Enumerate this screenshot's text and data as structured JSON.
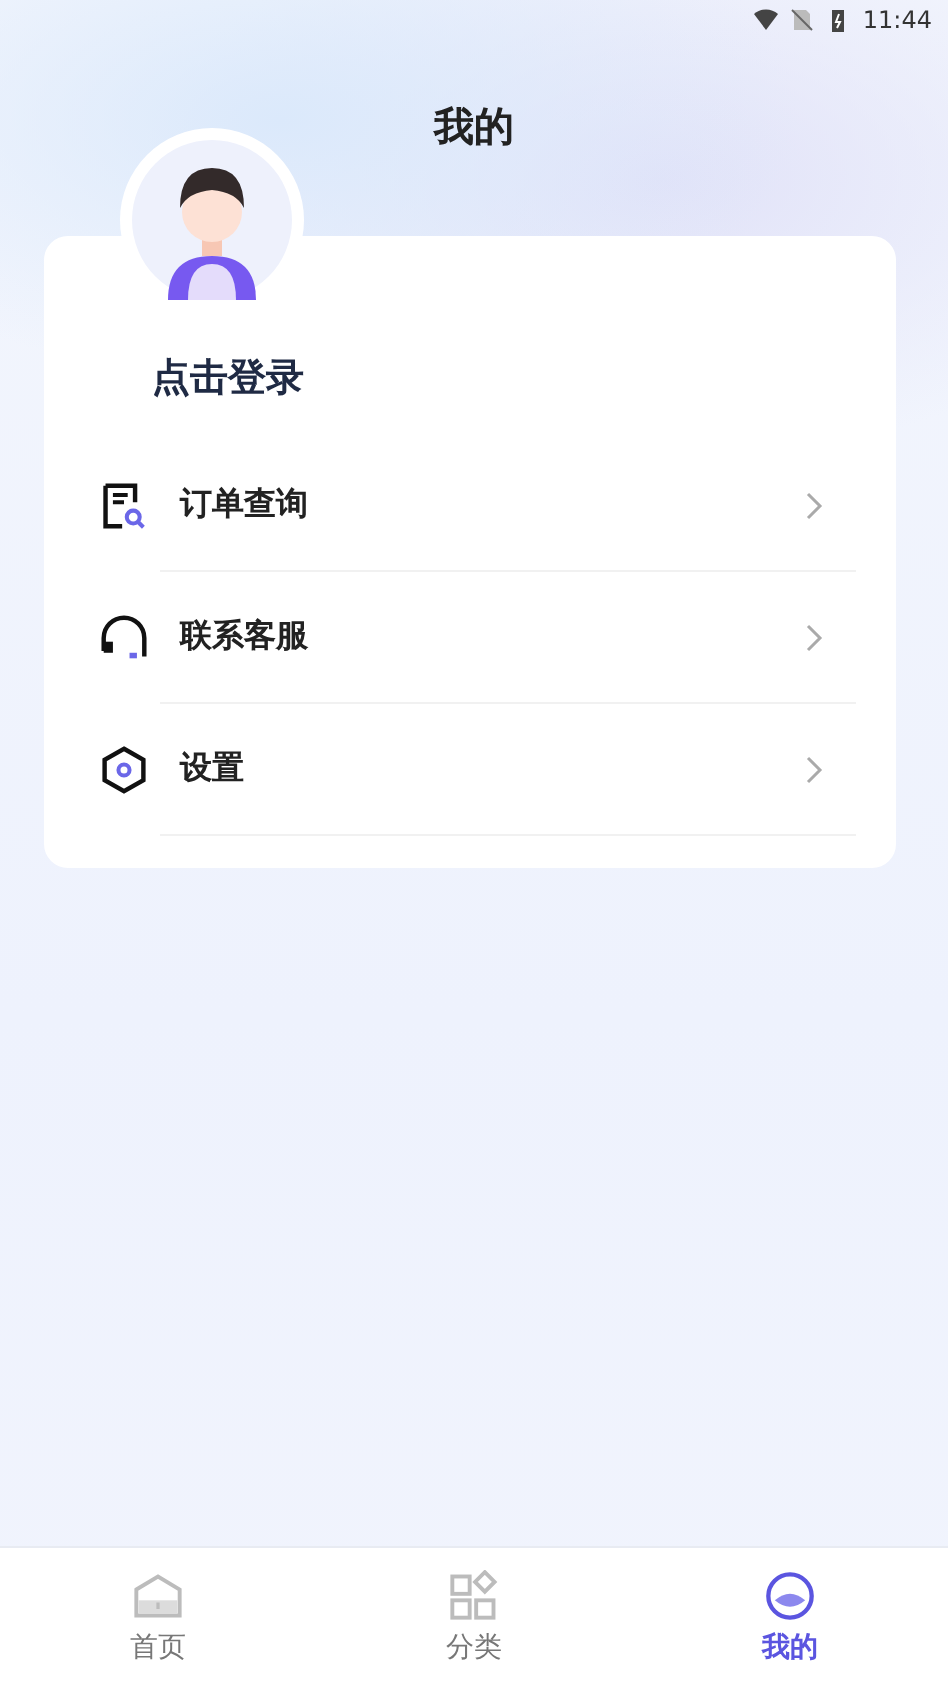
{
  "status_bar": {
    "time": "11:44"
  },
  "header": {
    "title": "我的"
  },
  "profile": {
    "login_label": "点击登录"
  },
  "menu": [
    {
      "kind": "orders",
      "label": "订单查询"
    },
    {
      "kind": "service",
      "label": "联系客服"
    },
    {
      "kind": "settings",
      "label": "设置"
    }
  ],
  "tabs": [
    {
      "kind": "home",
      "label": "首页",
      "selected": false
    },
    {
      "kind": "category",
      "label": "分类",
      "selected": false
    },
    {
      "kind": "mine",
      "label": "我的",
      "selected": true
    }
  ]
}
